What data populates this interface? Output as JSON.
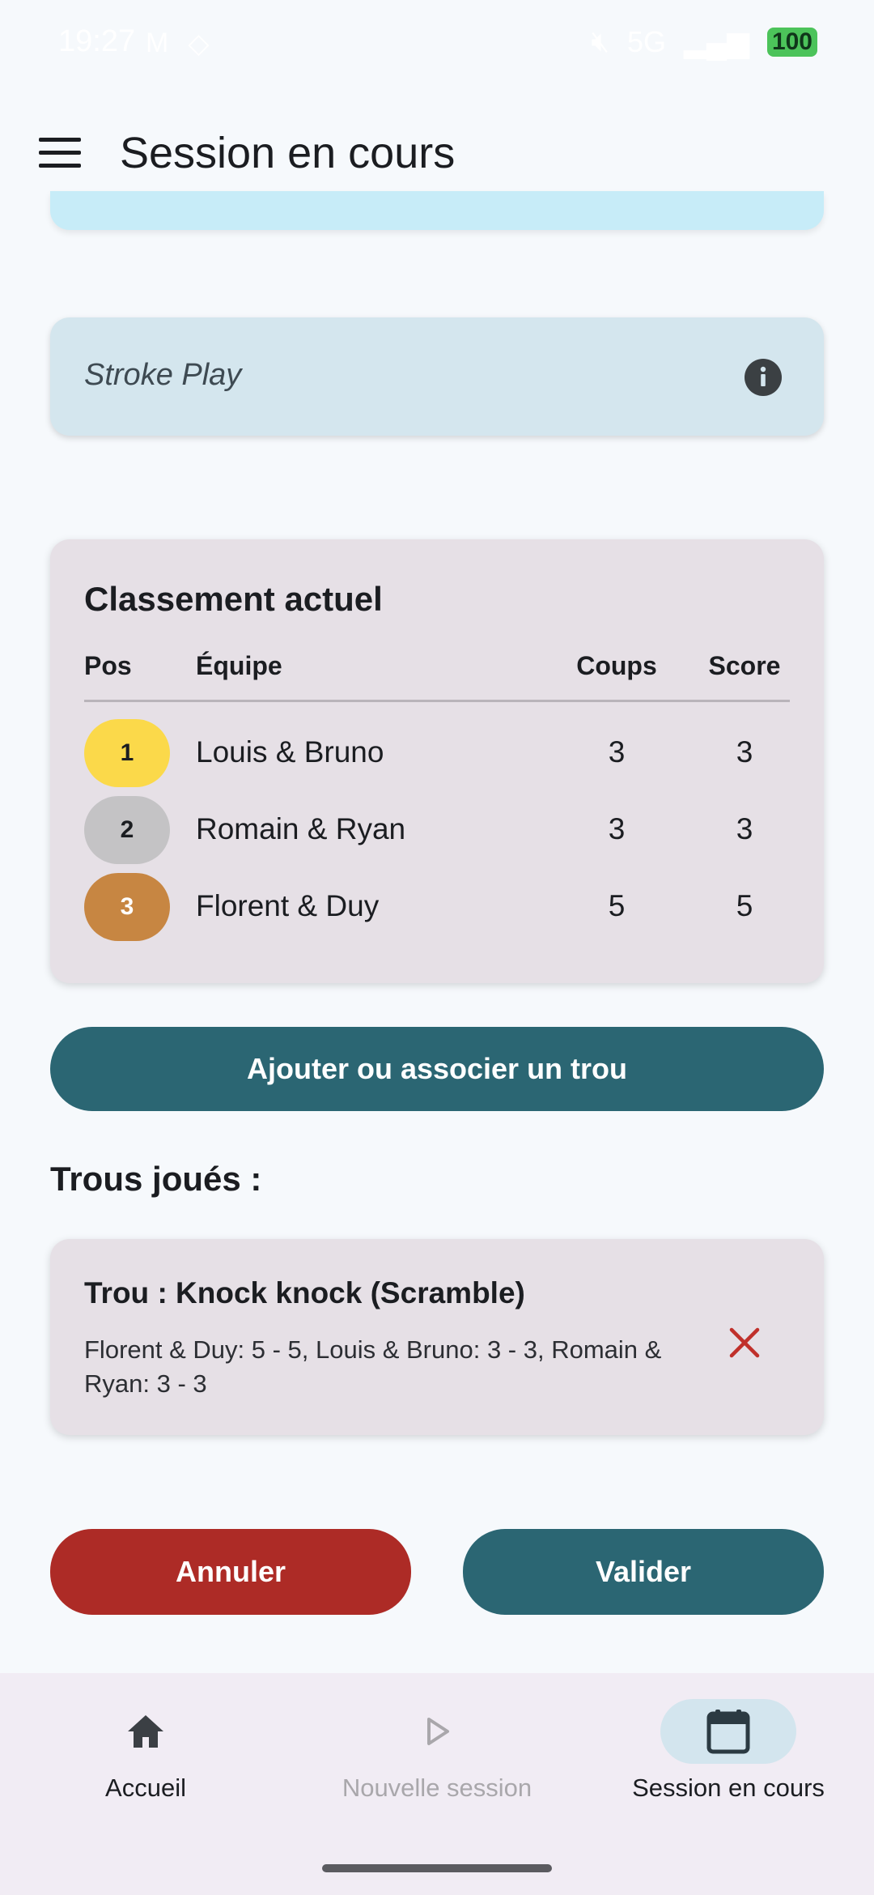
{
  "status_bar": {
    "time": "19:27",
    "network": "5G",
    "battery": "100"
  },
  "app_bar": {
    "title": "Session en cours"
  },
  "mode_card": {
    "label": "Stroke Play"
  },
  "ranking": {
    "title": "Classement actuel",
    "headers": {
      "pos": "Pos",
      "team": "Équipe",
      "strokes": "Coups",
      "score": "Score"
    },
    "rows": [
      {
        "pos": "1",
        "team": "Louis & Bruno",
        "strokes": "3",
        "score": "3",
        "badge_color": "#fbd94a",
        "badge_text_color": "#1b1d21"
      },
      {
        "pos": "2",
        "team": "Romain & Ryan",
        "strokes": "3",
        "score": "3",
        "badge_color": "#c4c3c5",
        "badge_text_color": "#1b1d21"
      },
      {
        "pos": "3",
        "team": "Florent & Duy",
        "strokes": "5",
        "score": "5",
        "badge_color": "#c78642",
        "badge_text_color": "#ffffff"
      }
    ]
  },
  "add_hole_button": {
    "label": "Ajouter ou associer un trou"
  },
  "holes": {
    "heading": "Trous joués :",
    "items": [
      {
        "title": "Trou : Knock knock (Scramble)",
        "detail": "Florent & Duy: 5 - 5, Louis & Bruno: 3 - 3, Romain & Ryan: 3 - 3"
      }
    ]
  },
  "actions": {
    "cancel_label": "Annuler",
    "validate_label": "Valider"
  },
  "bottom_nav": {
    "items": [
      {
        "label": "Accueil",
        "icon": "home-icon",
        "state": "normal"
      },
      {
        "label": "Nouvelle session",
        "icon": "play-icon",
        "state": "disabled"
      },
      {
        "label": "Session en cours",
        "icon": "calendar-icon",
        "state": "active"
      }
    ]
  },
  "colors": {
    "primary": "#2b6673",
    "danger": "#ad2b26",
    "card": "#e6e0e6",
    "mode_card": "#d4e6ee"
  }
}
